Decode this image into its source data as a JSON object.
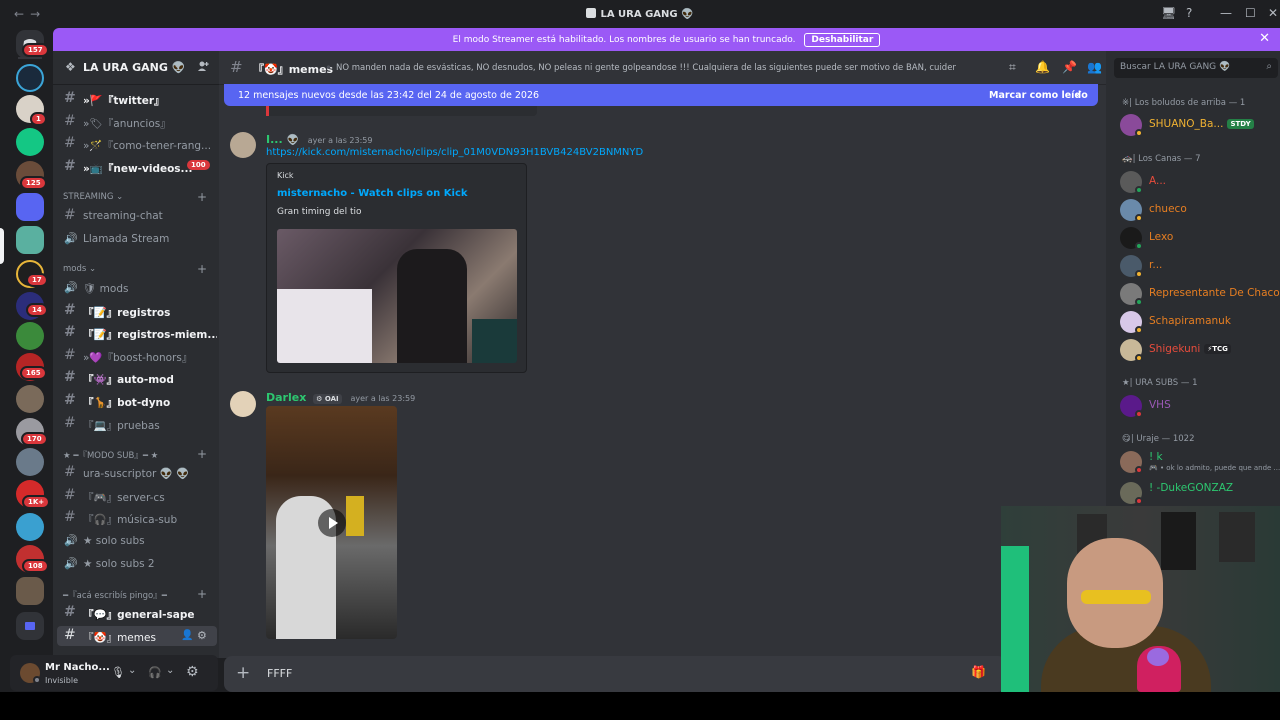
{
  "window": {
    "title": "LA URA GANG 👽",
    "back_label": "←",
    "forward_label": "→",
    "controls": [
      "🖥",
      "?",
      "—",
      "☐",
      "✕"
    ]
  },
  "rail": {
    "badges": [
      "157",
      "1",
      "125",
      "17",
      "14",
      "165",
      "170",
      "1K+",
      "108"
    ]
  },
  "banner": {
    "text": "El modo Streamer está habilitado. Los nombres de usuario se han truncado.",
    "button": "Deshabilitar",
    "close": "✕"
  },
  "guild": {
    "name": "LA URA GANG 👽",
    "chevron": "⌄"
  },
  "channels": {
    "top": [
      {
        "label": "»🚩『twitter』",
        "state": "unread"
      },
      {
        "label": "»🏷『anuncios』",
        "state": "normal"
      },
      {
        "label": "»🪄『como-tener-rang...",
        "state": "normal"
      },
      {
        "label": "»📺『new-videos...",
        "state": "unread",
        "badge": "100"
      }
    ],
    "streaming_category": "STREAMING",
    "streaming": [
      {
        "label": "streaming-chat",
        "type": "text"
      },
      {
        "label": "Llamada Stream",
        "type": "voice"
      }
    ],
    "mods_category": "mods",
    "mods": [
      {
        "label": "🛡 mods",
        "type": "voice",
        "state": "normal"
      },
      {
        "label": "『📝』registros",
        "type": "text",
        "state": "unread"
      },
      {
        "label": "『📝』registros-miem...",
        "type": "text",
        "state": "unread"
      },
      {
        "label": "»💜『boost-honors』",
        "type": "text",
        "state": "normal"
      },
      {
        "label": "『👾』auto-mod",
        "type": "text",
        "state": "unread"
      },
      {
        "label": "『🦒』bot-dyno",
        "type": "text",
        "state": "unread"
      },
      {
        "label": "『💻』pruebas",
        "type": "text",
        "state": "normal"
      }
    ],
    "sub_category": "★ ━『MODO SUB』━ ★",
    "sub": [
      {
        "label": "ura-suscriptor 👽 👽",
        "type": "text"
      },
      {
        "label": "『🎮』server-cs",
        "type": "text"
      },
      {
        "label": "『🎧』música-sub",
        "type": "text"
      },
      {
        "label": "★ solo subs",
        "type": "voice"
      },
      {
        "label": "★ solo subs 2",
        "type": "voice"
      }
    ],
    "pingo_category": "━『acá escribís pingo』━",
    "pingo": [
      {
        "label": "『💬』general-sape",
        "state": "unread"
      },
      {
        "label": "『🤡』memes",
        "state": "active"
      }
    ]
  },
  "user": {
    "name": "Mr Nacho...",
    "status": "Invisible",
    "mic_icon": "🎙",
    "headset_icon": "🎧",
    "settings_icon": "⚙"
  },
  "chat": {
    "channel_name": "『🤡』memes",
    "topic": "NO manden nada de esvásticas, NO desnudos, NO peleas ni gente golpeandose !!! Cualquiera de las siguientes puede ser motivo de BAN, cuiden el stream!",
    "new_messages": "12 mensajes nuevos desde las 23:42 del 24 de agosto de 2026",
    "mark_read": "Marcar como leído",
    "messages": [
      {
        "author": "I...",
        "author_color": "#2dc770",
        "timestamp": "ayer a las 23:59",
        "link": "https://kick.com/misternacho/clips/clip_01M0VDN93H1BVB424BV2BNMNYD",
        "embed": {
          "provider": "Kick",
          "title": "misternacho - Watch clips on Kick",
          "description": "Gran timing del tio"
        }
      },
      {
        "author": "Darlex",
        "author_color": "#2dc770",
        "tag": "⚙ OAI",
        "timestamp": "ayer a las 23:59"
      }
    ],
    "composer_text": "FFFF"
  },
  "members": {
    "search_placeholder": "Buscar LA URA GANG 👽",
    "groups": [
      {
        "title": "※| Los boludos de arriba — 1",
        "members": [
          {
            "name": "SHUANO_Ba...",
            "color": "#f0b232",
            "tag": "STDY",
            "tag_color": "#248046"
          }
        ]
      },
      {
        "title": "🚓| Los Canas — 7",
        "members": [
          {
            "name": "A...",
            "color": "#e74c3c"
          },
          {
            "name": "chueco",
            "color": "#e67e22"
          },
          {
            "name": "Lexo",
            "color": "#e67e22"
          },
          {
            "name": "r...",
            "color": "#e67e22"
          },
          {
            "name": "Representante De Chaco",
            "color": "#e67e22"
          },
          {
            "name": "Schapiramanuk",
            "color": "#e67e22"
          },
          {
            "name": "Shigekuni",
            "color": "#e74c3c",
            "tag": "⚡TCG",
            "tag_color": "#232428"
          }
        ]
      },
      {
        "title": "★| URA SUBS — 1",
        "members": [
          {
            "name": "VHS",
            "color": "#9b59b6"
          }
        ]
      },
      {
        "title": "😋| Uraje — 1022",
        "members": [
          {
            "name": "! k",
            "color": "#2dc770",
            "activity": "🎮 • ok lo admito, puede que ande ..."
          },
          {
            "name": "! -DukeGONZAZ",
            "color": "#2dc770"
          }
        ]
      }
    ]
  }
}
